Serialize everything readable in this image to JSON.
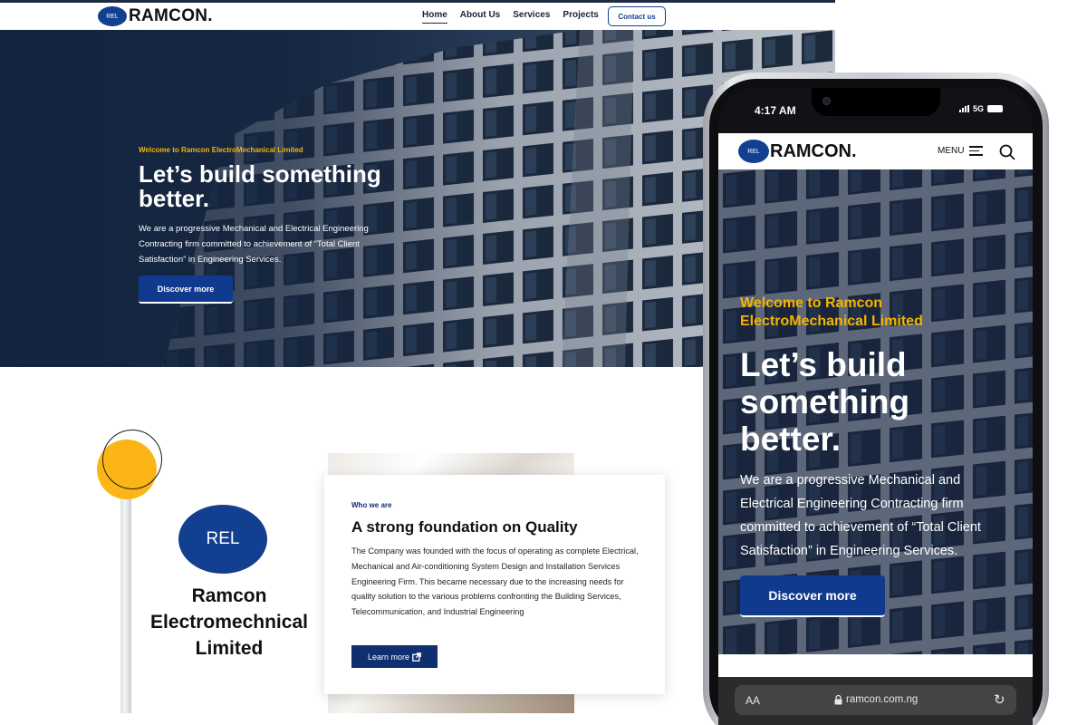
{
  "desktop": {
    "nav": {
      "logo_mark": "REL",
      "logo_text": "RAMCON.",
      "links": [
        "Home",
        "About Us",
        "Services",
        "Projects"
      ],
      "active_link": "Home",
      "contact_label": "Contact us"
    },
    "hero": {
      "kicker": "Welcome to Ramcon ElectroMechanical Limited",
      "title": "Let’s build something better.",
      "description": "We are a progressive Mechanical and Electrical Engineering Contracting firm committed to achievement of “Total Client Satisfaction” in Engineering Services.",
      "button_label": "Discover more"
    },
    "about": {
      "logo_mark": "REL",
      "company_name": "Ramcon Electromechnical Limited",
      "kicker": "Who we are",
      "title": "A strong foundation on Quality",
      "body": "The Company was founded with the focus of operating as complete Electrical, Mechanical and Air-conditioning System Design and Installation Services Engineering Firm. This became necessary due to the increasing needs for quality solution to the various problems confronting the Building Services, Telecommunication, and Industrial Engineering",
      "button_label": "Learn more",
      "button_icon": "external-link-icon"
    }
  },
  "mobile": {
    "status": {
      "time": "4:17 AM",
      "network": "5G"
    },
    "nav": {
      "logo_mark": "REL",
      "logo_text": "RAMCON.",
      "menu_label": "MENU"
    },
    "hero": {
      "kicker": "Welcome to Ramcon ElectroMechanical Limited",
      "title": "Let’s build something better.",
      "description": "We are a progressive Mechanical and Electrical Engineering Contracting firm committed to achievement of “Total Client Satisfaction” in Engineering Services.",
      "button_label": "Discover more"
    },
    "browser": {
      "text_size_label": "AA",
      "url": "ramcon.com.ng"
    }
  },
  "colors": {
    "brand_blue": "#123f8f",
    "navy": "#0f2f70",
    "accent_yellow": "#f5b400",
    "circle_yellow": "#fbb516"
  }
}
